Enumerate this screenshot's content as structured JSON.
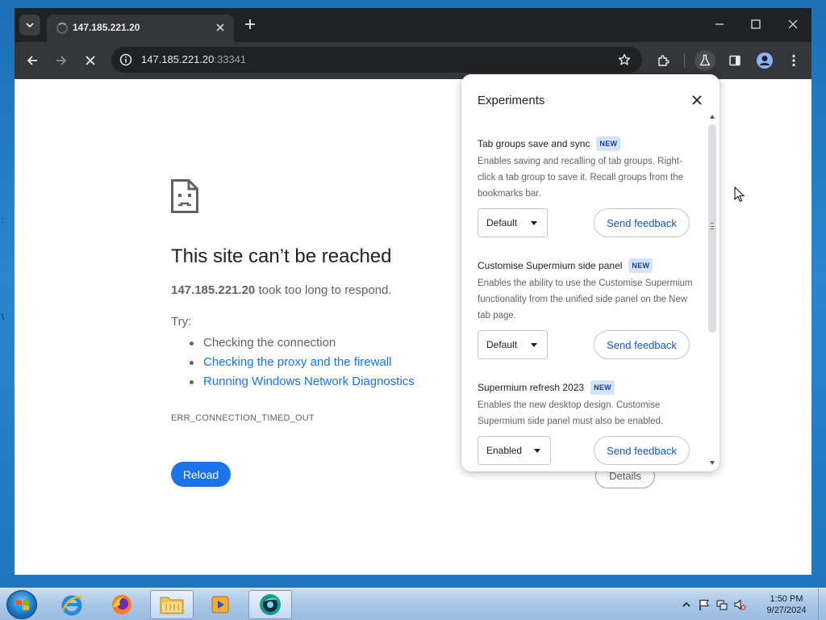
{
  "browser": {
    "tab_title": "147.185.221.20",
    "url_host": "147.185.221.20",
    "url_port": ":33341"
  },
  "error_page": {
    "title": "This site can’t be reached",
    "host": "147.185.221.20",
    "message_suffix": " took too long to respond.",
    "try_label": "Try:",
    "suggestions": [
      "Checking the connection",
      "Checking the proxy and the firewall",
      "Running Windows Network Diagnostics"
    ],
    "error_code": "ERR_CONNECTION_TIMED_OUT",
    "reload_label": "Reload",
    "details_label": "Details"
  },
  "experiments": {
    "title": "Experiments",
    "items": [
      {
        "name": "Tab groups save and sync",
        "badge": "NEW",
        "description": "Enables saving and recalling of tab groups. Right-click a tab group to save it. Recall groups from the bookmarks bar.",
        "selected": "Default",
        "feedback_label": "Send feedback"
      },
      {
        "name": "Customise Supermium side panel",
        "badge": "NEW",
        "description": "Enables the ability to use the Customise Supermium functionality from the unified side panel on the New tab page.",
        "selected": "Default",
        "feedback_label": "Send feedback"
      },
      {
        "name": "Supermium refresh 2023",
        "badge": "NEW",
        "description": "Enables the new desktop design. Customise Supermium side panel must also be enabled.",
        "selected": "Enabled",
        "feedback_label": "Send feedback"
      }
    ]
  },
  "taskbar": {
    "time": "1:50 PM",
    "date": "9/27/2024",
    "apps": [
      "internet-explorer",
      "firefox",
      "file-explorer",
      "media-player",
      "supermium"
    ]
  },
  "colors": {
    "accent": "#1a73e8",
    "chrome_dark": "#202124",
    "toolbar": "#35363a",
    "new_badge_bg": "#d3e3fd"
  }
}
